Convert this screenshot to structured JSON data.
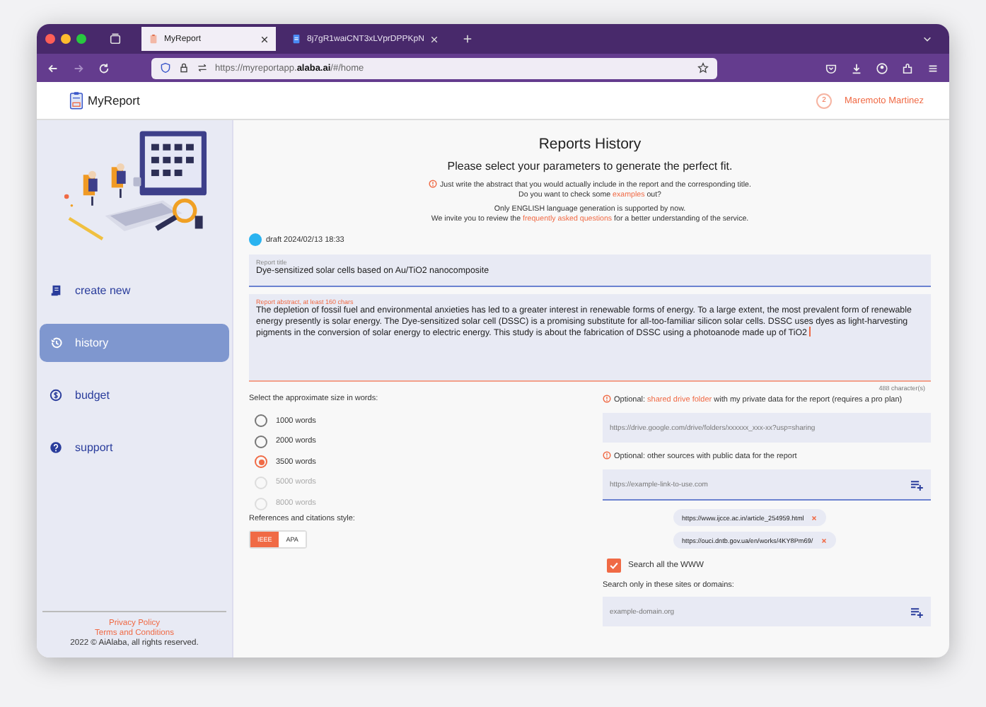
{
  "browser": {
    "tabs": [
      {
        "title": "MyReport",
        "kind": "app",
        "selected": true
      },
      {
        "title": "8j7gR1waiCNT3xLVprDPPKpN",
        "kind": "doc",
        "selected": false
      }
    ],
    "url": "https://myreportapp.**alaba.ai**/#/home"
  },
  "header": {
    "logo": "MyReport",
    "user_badge": "2",
    "user_name": "Maremoto Martinez"
  },
  "sidebar": {
    "items": [
      {
        "label": "create new",
        "kind": "document",
        "selected": false
      },
      {
        "label": "history",
        "kind": "history",
        "selected": true
      },
      {
        "label": "budget",
        "kind": "coin",
        "selected": false
      },
      {
        "label": "support",
        "kind": "help",
        "selected": false
      }
    ],
    "footer": {
      "privacy": "Privacy Policy",
      "terms": "Terms and Conditions",
      "copyright": "2022 © AiAlaba, all rights reserved."
    }
  },
  "main": {
    "title": "Reports History",
    "subtitle": "Please select your parameters to generate the perfect fit.",
    "notices": [
      {
        "kind": "warning",
        "lines": [
          [
            {
              "kind": "text",
              "text": "Just write the abstract that you would actually include in the report and the corresponding title."
            }
          ],
          [
            {
              "kind": "text",
              "text": "Do you want to check some "
            },
            {
              "kind": "link",
              "text": "examples"
            },
            {
              "kind": "text",
              "text": " out?"
            }
          ]
        ]
      },
      {
        "kind": "plain",
        "lines": [
          [
            {
              "kind": "text",
              "text": "Only ENGLISH language generation is supported by now."
            }
          ],
          [
            {
              "kind": "text",
              "text": "We invite you to review the "
            },
            {
              "kind": "link",
              "text": "frequently asked questions"
            },
            {
              "kind": "text",
              "text": " for a better understanding of the service."
            }
          ]
        ]
      }
    ],
    "draft": "draft 2024/02/13 18:33",
    "report_title": {
      "label": "Report title",
      "value": "Dye-sensitized solar cells based on Au/TiO2 nanocomposite"
    },
    "abstract": {
      "label": "Report abstract, at least 160 chars",
      "value": " The depletion of fossil fuel and environmental anxieties has led to a greater interest in renewable forms of energy. To a large extent, the most prevalent form of renewable energy presently is solar energy. The Dye-sensitized solar cell (DSSC) is a promising substitute for all-too-familiar silicon solar cells. DSSC uses dyes as light-harvesting pigments in the conversion of solar energy to electric energy. This study is about the fabrication of DSSC using a photoanode made up of TiO2",
      "count": "488 character(s)"
    },
    "size": {
      "label": "Select the approximate size in words:",
      "options": [
        {
          "label": "1000 words",
          "selected": false,
          "disabled": false
        },
        {
          "label": "2000 words",
          "selected": false,
          "disabled": false
        },
        {
          "label": "3500 words",
          "selected": true,
          "disabled": false
        },
        {
          "label": "5000 words",
          "selected": false,
          "disabled": true
        },
        {
          "label": "8000 words",
          "selected": false,
          "disabled": true
        }
      ]
    },
    "citation": {
      "label": "References and citations style:",
      "options": [
        {
          "label": "IEEE",
          "selected": true
        },
        {
          "label": "APA",
          "selected": false
        }
      ]
    },
    "drive": {
      "parts": [
        {
          "kind": "text",
          "text": "Optional: "
        },
        {
          "kind": "link",
          "text": "shared drive folder"
        },
        {
          "kind": "text",
          "text": " with my private data for the report (requires a pro plan)"
        }
      ],
      "placeholder": "https://drive.google.com/drive/folders/xxxxxx_xxx-xx?usp=sharing"
    },
    "sources": {
      "label": "Optional: other sources with public data for the report",
      "placeholder": "https://example-link-to-use.com",
      "chips": [
        "https://www.ijcce.ac.in/article_254959.html",
        "https://ouci.dntb.gov.ua/en/works/4KY8Pm69/"
      ]
    },
    "search_www": {
      "label": "Search all the WWW",
      "checked": true
    },
    "domains": {
      "label": "Search only in these sites or domains:",
      "placeholder": "example-domain.org"
    }
  }
}
